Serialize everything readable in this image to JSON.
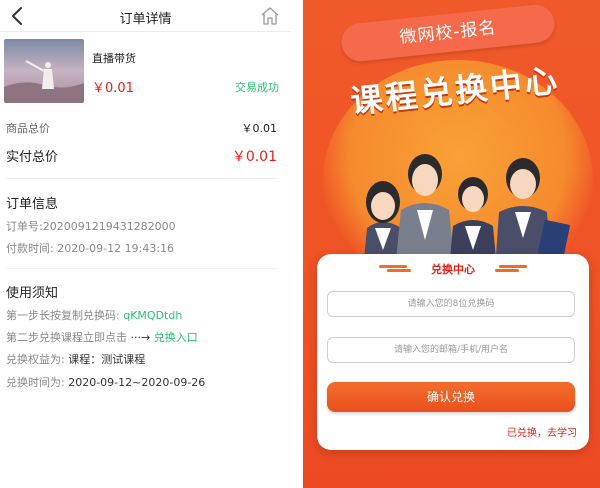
{
  "order": {
    "nav_title": "订单详情",
    "product_name": "直播带货",
    "product_price": "￥0.01",
    "status": "交易成功",
    "goods_total_label": "商品总价",
    "goods_total_value": "￥0.01",
    "paid_total_label": "实付总价",
    "paid_total_value": "￥0.01",
    "info_title": "订单信息",
    "order_no": "订单号:2020091219431282000",
    "pay_time_label": "付款时间:",
    "pay_time_value": "2020-09-12 19:43:16",
    "notice_title": "使用须知",
    "step1_label": "第一步长按复制兑换码:",
    "step1_code": "qKMQDtdh",
    "step2_label": "第二步兑换课程立即点击",
    "step2_arrow": "···→",
    "step2_link": "兑换入口",
    "benefit_label": "兑换权益为:",
    "benefit_value": "课程：测试课程",
    "time_label": "兑换时间为:",
    "time_value": "2020-09-12~2020-09-26"
  },
  "redeem": {
    "pill_text": "微网校-报名",
    "big_title": "课程兑换中心",
    "card_title": "兑换中心",
    "code_placeholder": "请输入您的8位兑换码",
    "account_placeholder": "请输入您的邮箱/手机/用户名",
    "confirm_label": "确认兑换",
    "learn_link": "已兑换，去学习"
  },
  "colors": {
    "price_red": "#e2231a",
    "success_green": "#2fbf71",
    "brand_orange": "#f05a2a"
  }
}
